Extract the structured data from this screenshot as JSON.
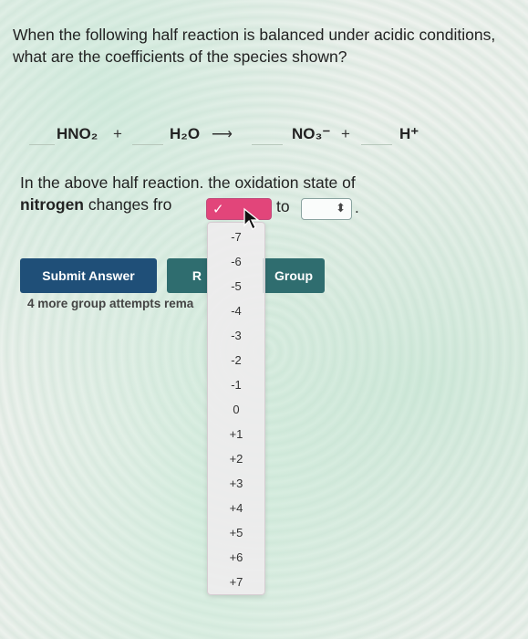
{
  "question": {
    "text": "When the following half reaction is balanced under acidic conditions, what are the coefficients of the species shown?"
  },
  "reaction": {
    "species1": "HNO₂",
    "plus1": "+",
    "species2": "H₂O",
    "arrow": "⟶",
    "species3": "NO₃⁻",
    "plus2": "+",
    "species4": "H⁺"
  },
  "oxidation": {
    "prefix": "In the above half reaction. the oxidation state of",
    "bold": "nitrogen",
    "middle": "changes fro",
    "to_label": "to",
    "period": "."
  },
  "dropdown": {
    "selected_check": "✓",
    "to_arrows": "⬍",
    "options": [
      "-7",
      "-6",
      "-5",
      "-4",
      "-3",
      "-2",
      "-1",
      "0",
      "+1",
      "+2",
      "+3",
      "+4",
      "+5",
      "+6",
      "+7"
    ]
  },
  "buttons": {
    "submit": "Submit Answer",
    "retry_partial": "R",
    "group": "Group"
  },
  "attempts_text": "4 more group attempts rema",
  "colors": {
    "submit_bg": "#1f4f78",
    "group_bg": "#2f6d6f",
    "select_active": "#e2457a"
  }
}
